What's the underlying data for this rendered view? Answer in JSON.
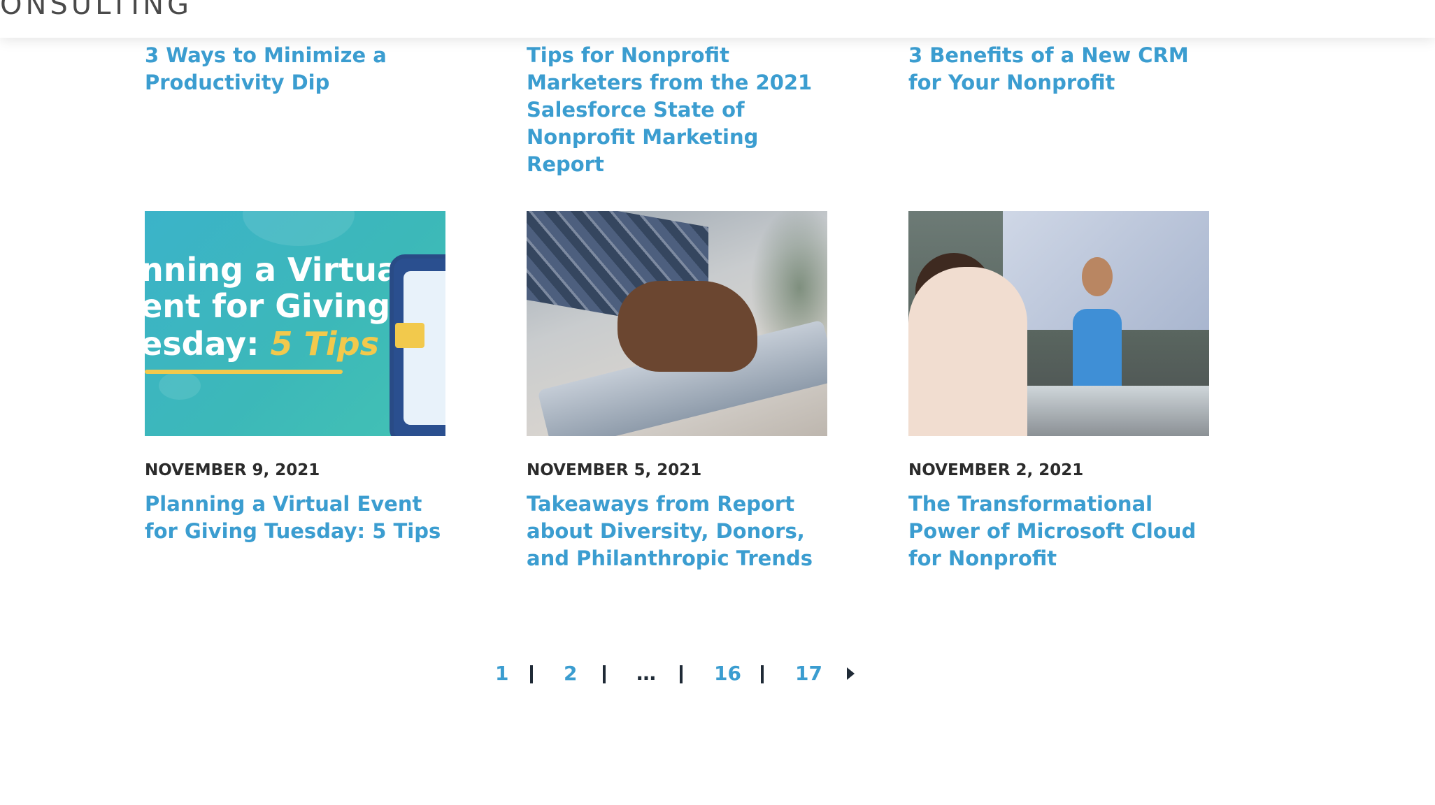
{
  "header": {
    "logo_fragment": "ONSULTING"
  },
  "top_posts": [
    {
      "title": "3 Ways to Minimize a Productivity Dip"
    },
    {
      "title": "Tips for Nonprofit Marketers from the 2021 Salesforce State of Nonprofit Marketing Report"
    },
    {
      "title": "3 Benefits of a New CRM for Your Nonprofit"
    }
  ],
  "posts": [
    {
      "date": "NOVEMBER 9, 2021",
      "title": "Planning a Virtual Event for Giving Tuesday: 5 Tips",
      "thumb_lines": [
        "nning a Virtual",
        "ent for Giving",
        "esday: "
      ],
      "thumb_accent": "5 Tips"
    },
    {
      "date": "NOVEMBER 5, 2021",
      "title": "Takeaways from Report about Diversity, Donors, and Philanthropic Trends"
    },
    {
      "date": "NOVEMBER 2, 2021",
      "title": "The Transformational Power of Microsoft Cloud for Nonprofit"
    }
  ],
  "pagination": {
    "pages": [
      "1",
      "2",
      "…",
      "16",
      "17"
    ],
    "current": "1",
    "next_icon": "triangle-right-icon"
  },
  "colors": {
    "link": "#3b9dd0",
    "text": "#2b2b2b",
    "accent": "#f2c94c"
  }
}
